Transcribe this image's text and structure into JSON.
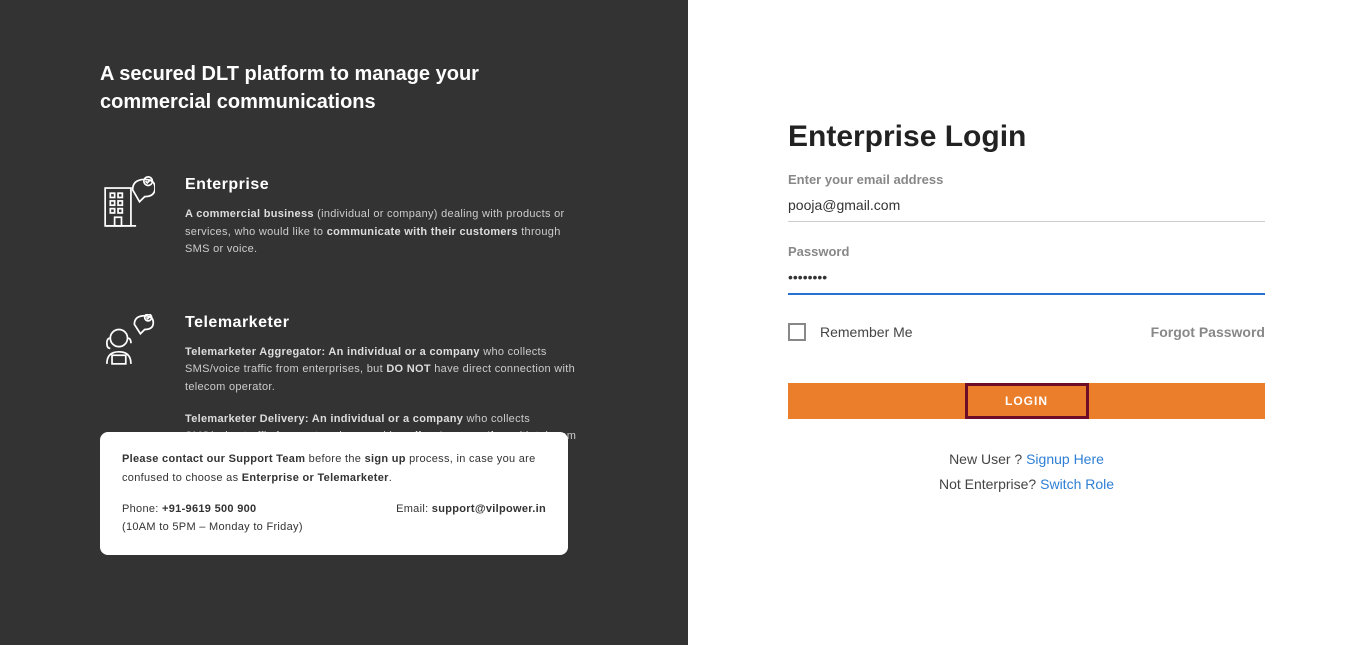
{
  "left": {
    "headline": "A secured DLT platform to manage your commercial communications",
    "enterprise": {
      "title": "Enterprise",
      "bold1": "A commercial business",
      "mid1": " (individual or company) dealing with products or services, who would like to ",
      "bold2": "communicate with their customers",
      "end": " through SMS or voice."
    },
    "telemarketer": {
      "title": "Telemarketer",
      "agg_bold1": "Telemarketer Aggregator: An individual or a company",
      "agg_mid": " who collects SMS/voice traffic from enterprises, but ",
      "agg_bold2": "DO NOT",
      "agg_end": " have direct connection with telecom operator.",
      "del_bold1": "Telemarketer Delivery: An individual or a company",
      "del_mid": " who collects SMS/voice traffic from enterprises, and has ",
      "del_bold2": "direct connection",
      "del_end": " with  telecom operator."
    },
    "support": {
      "pre": "Please contact our Support Team",
      "mid1": " before the ",
      "bold2": "sign up",
      "mid2": " process, in case you are confused to choose as ",
      "bold3": "Enterprise or Telemarketer",
      "end": ".",
      "phone_label": "Phone: ",
      "phone": "+91-9619 500 900",
      "hours": "(10AM to 5PM – Monday to Friday)",
      "email_label": "Email: ",
      "email": "support@vilpower.in"
    }
  },
  "right": {
    "title": "Enterprise Login",
    "email_label": "Enter your email address",
    "email_value": "pooja@gmail.com",
    "password_label": "Password",
    "password_value": "••••••••",
    "remember": "Remember Me",
    "forgot": "Forgot Password",
    "login_btn": "LOGIN",
    "newuser_pre": "New User ? ",
    "newuser_link": "Signup Here",
    "notent_pre": "Not Enterprise? ",
    "notent_link": "Switch Role"
  }
}
